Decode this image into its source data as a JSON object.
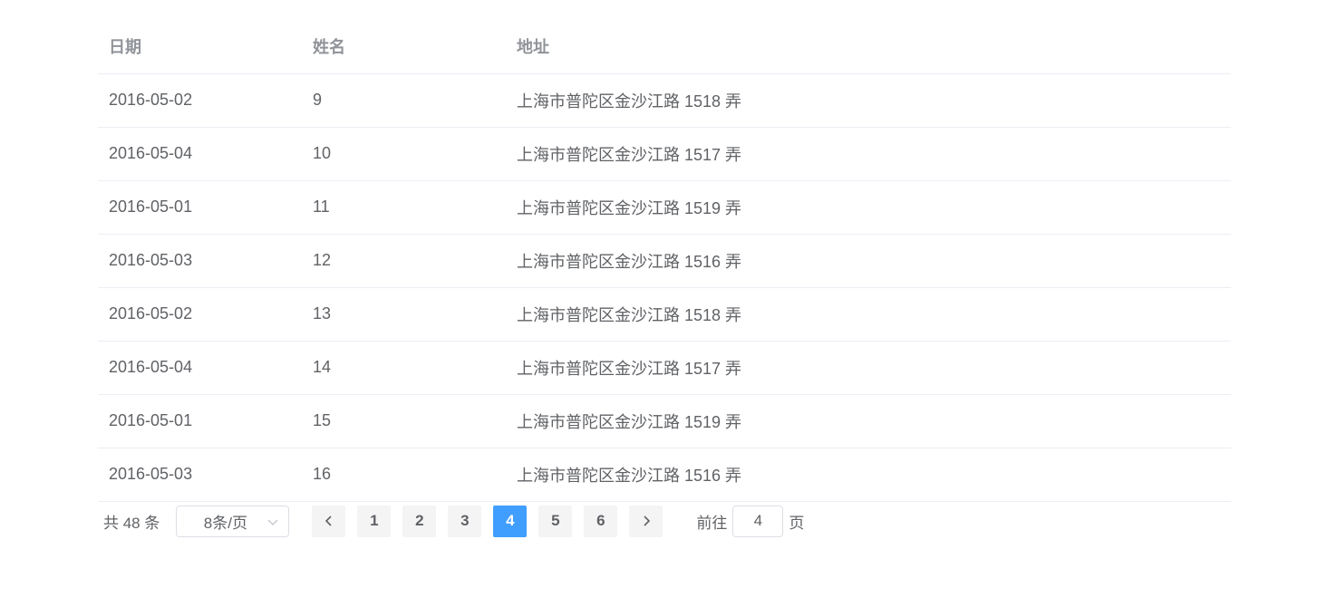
{
  "table": {
    "headers": [
      "日期",
      "姓名",
      "地址"
    ],
    "rows": [
      [
        "2016-05-02",
        "9",
        "上海市普陀区金沙江路 1518 弄"
      ],
      [
        "2016-05-04",
        "10",
        "上海市普陀区金沙江路 1517 弄"
      ],
      [
        "2016-05-01",
        "11",
        "上海市普陀区金沙江路 1519 弄"
      ],
      [
        "2016-05-03",
        "12",
        "上海市普陀区金沙江路 1516 弄"
      ],
      [
        "2016-05-02",
        "13",
        "上海市普陀区金沙江路 1518 弄"
      ],
      [
        "2016-05-04",
        "14",
        "上海市普陀区金沙江路 1517 弄"
      ],
      [
        "2016-05-01",
        "15",
        "上海市普陀区金沙江路 1519 弄"
      ],
      [
        "2016-05-03",
        "16",
        "上海市普陀区金沙江路 1516 弄"
      ]
    ]
  },
  "pagination": {
    "total_label": "共 48 条",
    "page_size": "8条/页",
    "pages": [
      "1",
      "2",
      "3",
      "4",
      "5",
      "6"
    ],
    "current_page": "4",
    "goto_prefix": "前往",
    "goto_value": "4",
    "goto_suffix": "页",
    "active_color": "#409eff"
  },
  "icons": {
    "prev": "chevron-left-icon",
    "next": "chevron-right-icon",
    "dropdown": "chevron-down-icon"
  }
}
